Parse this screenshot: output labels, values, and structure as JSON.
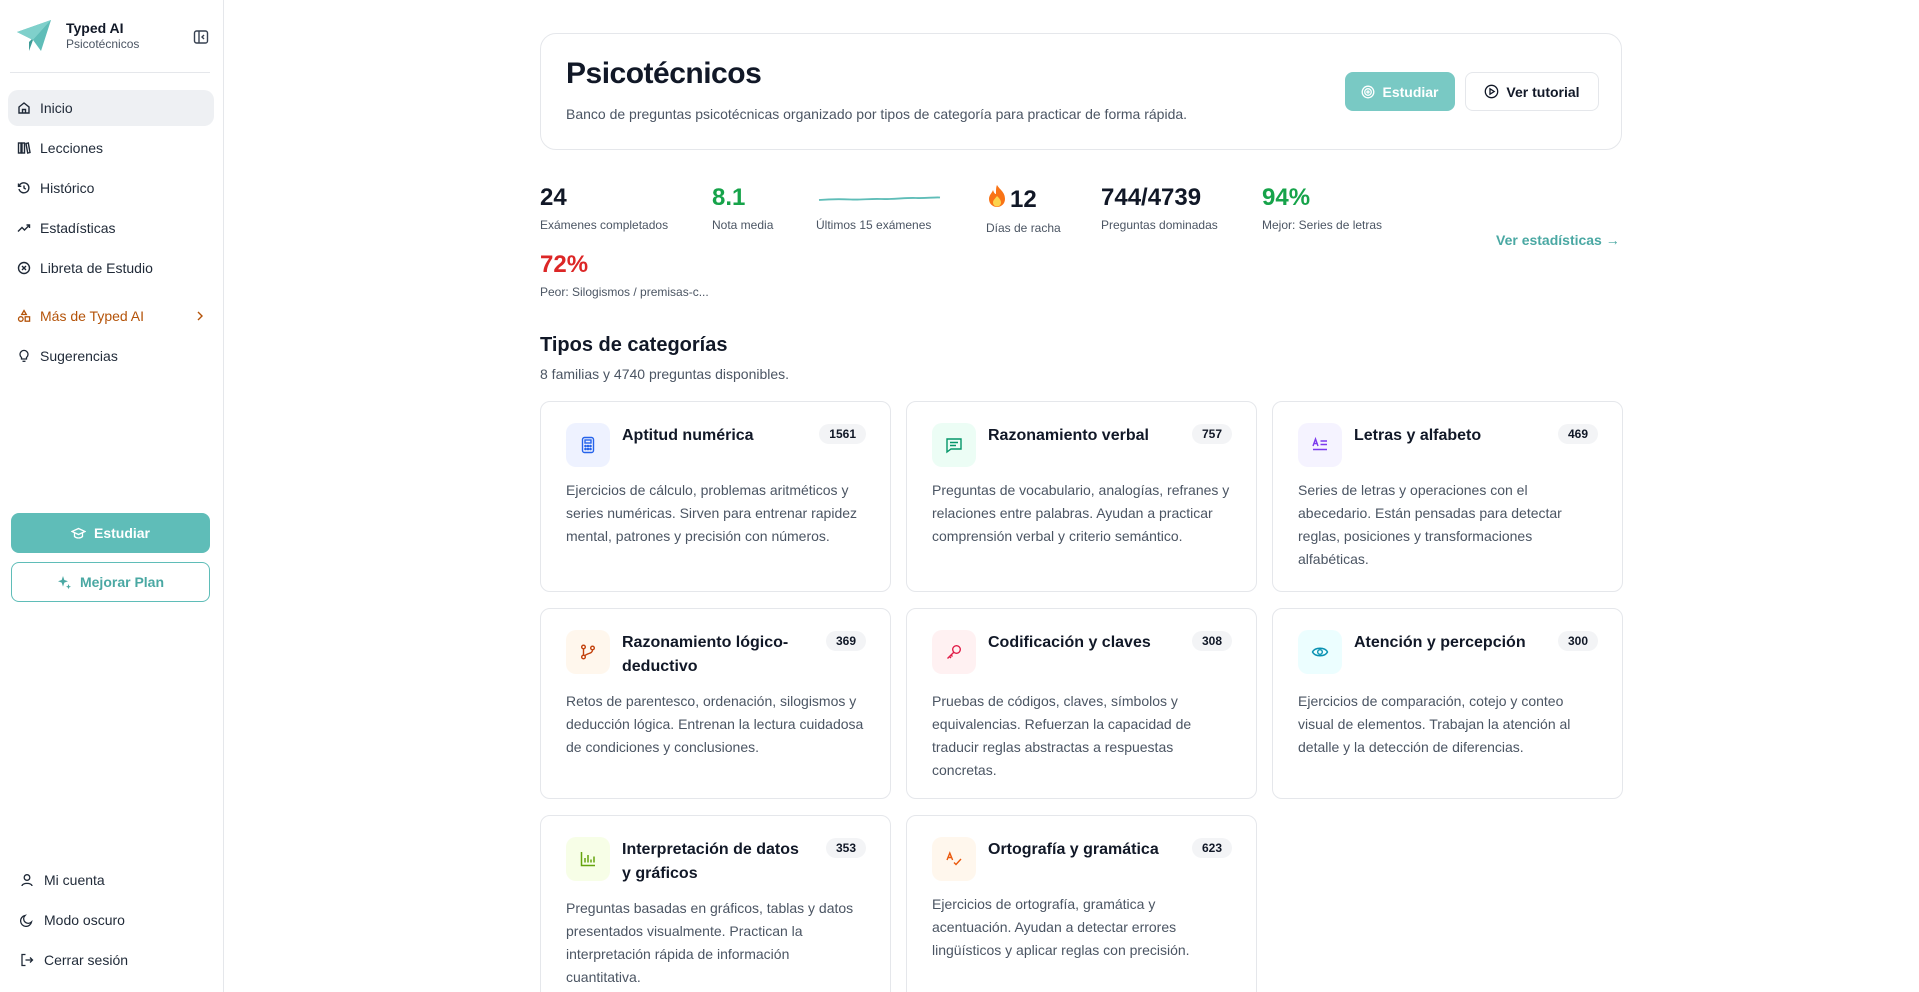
{
  "brand": {
    "name": "Typed AI",
    "subtitle": "Psicotécnicos"
  },
  "sidebar": {
    "items": [
      {
        "label": "Inicio",
        "icon": "home-icon",
        "active": true
      },
      {
        "label": "Lecciones",
        "icon": "books-icon"
      },
      {
        "label": "Histórico",
        "icon": "history-icon"
      },
      {
        "label": "Estadísticas",
        "icon": "trend-icon"
      },
      {
        "label": "Libreta de Estudio",
        "icon": "notebook-icon"
      }
    ],
    "more_label": "Más de Typed AI",
    "suggestions_label": "Sugerencias",
    "study_button": "Estudiar",
    "upgrade_button": "Mejorar Plan",
    "footer": [
      {
        "label": "Mi cuenta",
        "icon": "user-icon"
      },
      {
        "label": "Modo oscuro",
        "icon": "moon-icon"
      },
      {
        "label": "Cerrar sesión",
        "icon": "logout-icon"
      }
    ]
  },
  "header": {
    "title": "Psicotécnicos",
    "description": "Banco de preguntas psicotécnicas organizado por tipos de categoría para practicar de forma rápida.",
    "study_button": "Estudiar",
    "tutorial_button": "Ver tutorial"
  },
  "stats": {
    "completed": {
      "value": "24",
      "label": "Exámenes completados"
    },
    "average": {
      "value": "8.1",
      "label": "Nota media"
    },
    "trend": {
      "label": "Últimos 15 exámenes"
    },
    "streak": {
      "value": "12",
      "label": "Días de racha"
    },
    "mastered": {
      "value": "744/4739",
      "label": "Preguntas dominadas"
    },
    "best": {
      "value": "94%",
      "label": "Mejor: Series de letras"
    },
    "worst": {
      "value": "72%",
      "label": "Peor: Silogismos / premisas-c..."
    },
    "link": "Ver estadísticas →"
  },
  "categories_section": {
    "title": "Tipos de categorías",
    "subtitle": "8 familias y 4740 preguntas disponibles."
  },
  "categories": [
    {
      "title": "Aptitud numérica",
      "count": "1561",
      "icon": "calculator-icon",
      "color": "#2563eb",
      "bg": "#eef2ff",
      "description": "Ejercicios de cálculo, problemas aritméticos y series numéricas. Sirven para entrenar rapidez mental, patrones y precisión con números."
    },
    {
      "title": "Razonamiento verbal",
      "count": "757",
      "icon": "chat-icon",
      "color": "#059669",
      "bg": "#ecfdf5",
      "description": "Preguntas de vocabulario, analogías, refranes y relaciones entre palabras. Ayudan a practicar comprensión verbal y criterio semántico."
    },
    {
      "title": "Letras y alfabeto",
      "count": "469",
      "icon": "alphabet-icon",
      "color": "#7c3aed",
      "bg": "#f5f3ff",
      "description": "Series de letras y operaciones con el abecedario. Están pensadas para detectar reglas, posiciones y transformaciones alfabéticas."
    },
    {
      "title": "Razonamiento lógico-deductivo",
      "count": "369",
      "icon": "branch-icon",
      "color": "#c2410c",
      "bg": "#fff7ed",
      "description": "Retos de parentesco, ordenación, silogismos y deducción lógica. Entrenan la lectura cuidadosa de condiciones y conclusiones."
    },
    {
      "title": "Codificación y claves",
      "count": "308",
      "icon": "key-icon",
      "color": "#e11d48",
      "bg": "#fff1f2",
      "description": "Pruebas de códigos, claves, símbolos y equivalencias. Refuerzan la capacidad de traducir reglas abstractas a respuestas concretas."
    },
    {
      "title": "Atención y percepción",
      "count": "300",
      "icon": "eye-icon",
      "color": "#0891b2",
      "bg": "#ecfeff",
      "description": "Ejercicios de comparación, cotejo y conteo visual de elementos. Trabajan la atención al detalle y la detección de diferencias."
    },
    {
      "title": "Interpretación de datos y gráficos",
      "count": "353",
      "icon": "bar-chart-icon",
      "color": "#65a30d",
      "bg": "#f7fee7",
      "description": "Preguntas basadas en gráficos, tablas y datos presentados visualmente. Practican la interpretación rápida de información cuantitativa."
    },
    {
      "title": "Ortografía y gramática",
      "count": "623",
      "icon": "spellcheck-icon",
      "color": "#ea580c",
      "bg": "#fff7ed",
      "description": "Ejercicios de ortografía, gramática y acentuación. Ayudan a detectar errores lingüísticos y aplicar reglas con precisión."
    }
  ]
}
